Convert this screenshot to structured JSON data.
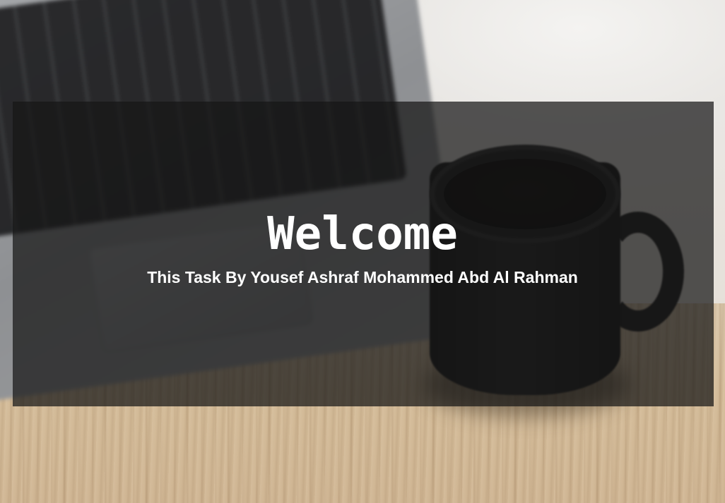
{
  "hero": {
    "title": "Welcome",
    "subtitle": "This Task By Yousef Ashraf Mohammed Abd Al Rahman"
  }
}
